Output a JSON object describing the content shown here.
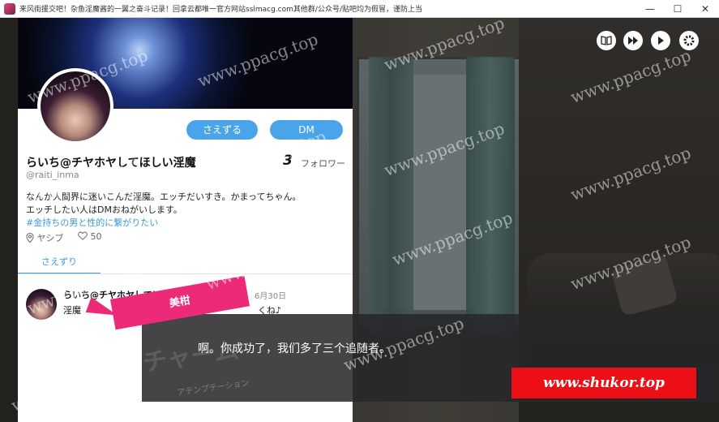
{
  "window": {
    "title": "来风街援交吧！杂鱼淫魔酱的一翼之奋斗记录！回拿云都唯一官方网站sslmacg.com其他群/公众号/贴吧均为假冒，谨防上当",
    "minimize": "—",
    "maximize": "☐",
    "close": "✕"
  },
  "profile": {
    "follow_button": "さえずる",
    "dm_button": "DM",
    "name": "らいち@チヤホヤしてほしい淫魔",
    "handle": "@raiti_inma",
    "follower_count": "3",
    "follower_label": "フォロワー",
    "bio_line1": "なんか人間界に迷いこんだ淫魔。エッチだいすき。かまってちゃん。",
    "bio_line2": "エッチしたい人はDMおねがいします。",
    "hashtag": "#金持ちの男と性的に繋がりたい",
    "location": "ヤシブ",
    "likes": "50",
    "tab_label": "さえずり"
  },
  "post": {
    "name": "らいち@チヤホヤしてほしい淫魔",
    "date": "6月30日",
    "text_start": "淫魔",
    "text_end": "くね♪"
  },
  "controls": {
    "backlog_icon": "book-icon",
    "skip_icon": "fast-forward-icon",
    "auto_icon": "play-icon",
    "settings_icon": "gear-icon"
  },
  "dialog": {
    "speaker": "美柑",
    "text": "啊。你成功了，我们多了三个追随者。",
    "stamp_text": "チャーム",
    "stamp_subtext": "アテンプテーション"
  },
  "watermark": {
    "text": "www.ppacg.top",
    "site_badge": "www.shukor.top"
  }
}
